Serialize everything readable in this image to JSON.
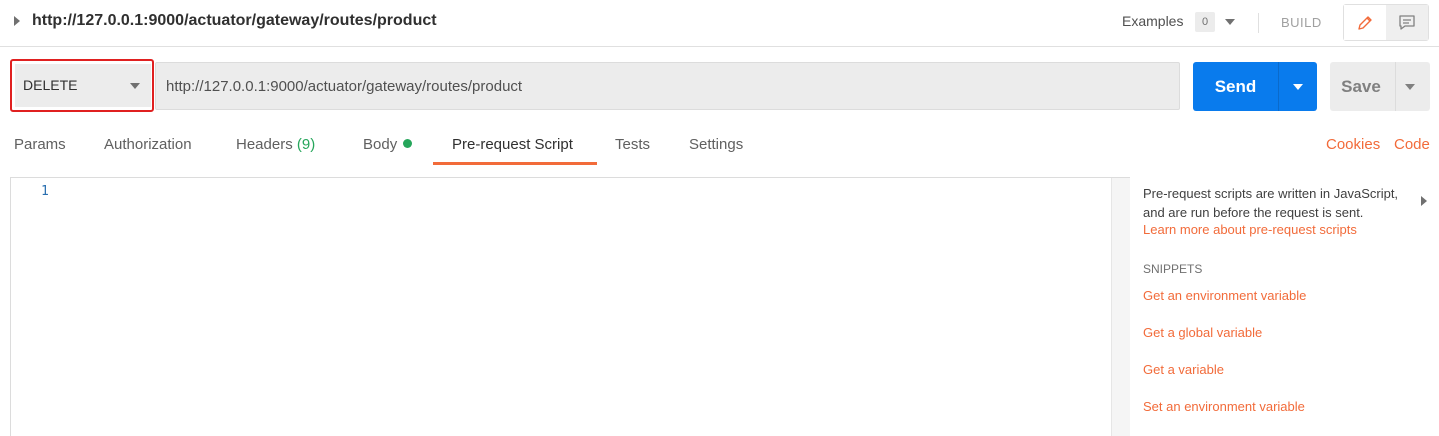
{
  "request": {
    "title": "http://127.0.0.1:9000/actuator/gateway/routes/product",
    "method": "DELETE",
    "url": "http://127.0.0.1:9000/actuator/gateway/routes/product"
  },
  "toolbar": {
    "examples_label": "Examples",
    "examples_count": "0",
    "build_label": "BUILD",
    "send_label": "Send",
    "save_label": "Save"
  },
  "tabs": {
    "params": "Params",
    "authorization": "Authorization",
    "headers": "Headers",
    "headers_count": "(9)",
    "body": "Body",
    "prerequest": "Pre-request Script",
    "tests": "Tests",
    "settings": "Settings",
    "cookies": "Cookies",
    "code": "Code"
  },
  "editor": {
    "line_number": "1"
  },
  "side_pane": {
    "description": "Pre-request scripts are written in JavaScript, and are run before the request is sent.",
    "learn_more": "Learn more about pre-request scripts",
    "snippets_title": "SNIPPETS",
    "snippets": [
      "Get an environment variable",
      "Get a global variable",
      "Get a variable",
      "Set an environment variable"
    ]
  },
  "colors": {
    "accent": "#f26b3a",
    "send_blue": "#097bed",
    "highlight_red": "#e02020",
    "status_green": "#26a65b"
  },
  "icons": [
    "collapse-caret-icon",
    "pencil-icon",
    "comment-icon",
    "chevron-down-icon"
  ]
}
